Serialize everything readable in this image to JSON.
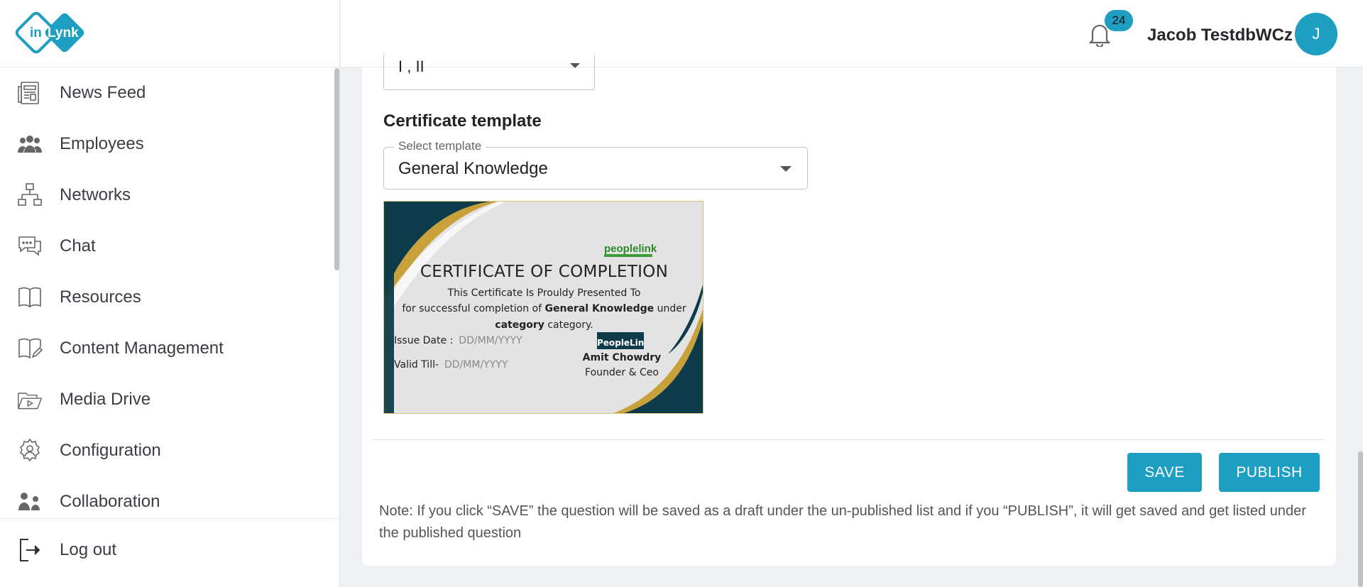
{
  "app": {
    "logo_text": "inLynk",
    "accent_color": "#1e9ec0"
  },
  "sidebar": {
    "items": [
      {
        "label": "News Feed",
        "icon": "newspaper-icon"
      },
      {
        "label": "Employees",
        "icon": "people-icon"
      },
      {
        "label": "Networks",
        "icon": "network-icon"
      },
      {
        "label": "Chat",
        "icon": "chat-icon"
      },
      {
        "label": "Resources",
        "icon": "book-icon"
      },
      {
        "label": "Content Management",
        "icon": "edit-book-icon"
      },
      {
        "label": "Media Drive",
        "icon": "media-folder-icon"
      },
      {
        "label": "Configuration",
        "icon": "gear-user-icon"
      },
      {
        "label": "Collaboration",
        "icon": "collaboration-icon"
      }
    ],
    "logout_label": "Log out"
  },
  "header": {
    "notification_count": "24",
    "user_name": "Jacob TestdbWCz",
    "avatar_initial": "J"
  },
  "form": {
    "previous_select_value": "I , II",
    "certificate_section_title": "Certificate template",
    "template_select": {
      "label": "Select template",
      "value": "General Knowledge"
    }
  },
  "certificate": {
    "brand": "peoplelink",
    "title": "CERTIFICATE OF COMPLETION",
    "line1": "This Certificate Is Prouldy Presented To",
    "line2_prefix": "for successful completion of",
    "course": "General Knowledge",
    "line2_suffix": "under",
    "category_bold": "category",
    "category_suffix": "category.",
    "issue_label": "Issue Date :",
    "issue_value": "DD/MM/YYYY",
    "valid_label": "Valid Till-",
    "valid_value": "DD/MM/YYYY",
    "signature_logo": "PeopleLink",
    "signer_name": "Amit Chowdry",
    "signer_title": "Founder & Ceo"
  },
  "actions": {
    "save_label": "SAVE",
    "publish_label": "PUBLISH",
    "note": "Note: If you click “SAVE” the question will be saved as a draft under the un-published list and if you “PUBLISH”, it will get saved and get listed under the published question"
  }
}
